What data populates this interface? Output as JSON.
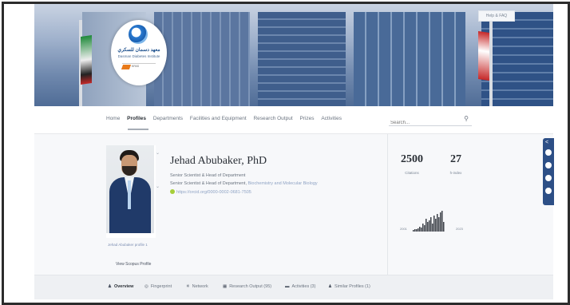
{
  "banner": {
    "help_label": "Help & FAQ",
    "logo_arabic": "معهد دسمان للسكري",
    "logo_english": "Dasman Diabetes Institute",
    "logo_partner": "KFAS"
  },
  "nav": {
    "items": [
      "Home",
      "Profiles",
      "Departments",
      "Facilities and Equipment",
      "Research Output",
      "Prizes",
      "Activities"
    ],
    "active": "Profiles",
    "search_placeholder": "Search..."
  },
  "profile": {
    "name": "Jehad Abubaker, PhD",
    "role_1": "Senior Scientist & Head of Department",
    "role_2_prefix": "Senior Scientist & Head of Department, ",
    "role_2_department": "Biochemistry and Molecular Biology",
    "orcid": "https://orcid.org/0000-0002-0681-7505",
    "scopus_link": "Jehad Abubaker profile 1",
    "scopus_view": "View Scopus Profile"
  },
  "stats": {
    "citations_value": "2500",
    "citations_label": "Citations",
    "hindex_value": "27",
    "hindex_label": "h-index",
    "year_start": "2001",
    "year_end": "2023"
  },
  "tabs": [
    {
      "label": "Overview",
      "icon": "person-icon",
      "glyph": "♟"
    },
    {
      "label": "Fingerprint",
      "icon": "fingerprint-icon",
      "glyph": "◎"
    },
    {
      "label": "Network",
      "icon": "network-icon",
      "glyph": "✳"
    },
    {
      "label": "Research Output (95)",
      "icon": "research-output-icon",
      "glyph": "▦"
    },
    {
      "label": "Activities (3)",
      "icon": "activities-icon",
      "glyph": "▬"
    },
    {
      "label": "Similar Profiles (1)",
      "icon": "similar-profiles-icon",
      "glyph": "♟"
    }
  ],
  "colors": {
    "share_rail": "#2d4f86",
    "link": "#8fa3c4",
    "orcid_green": "#a6ce39"
  }
}
